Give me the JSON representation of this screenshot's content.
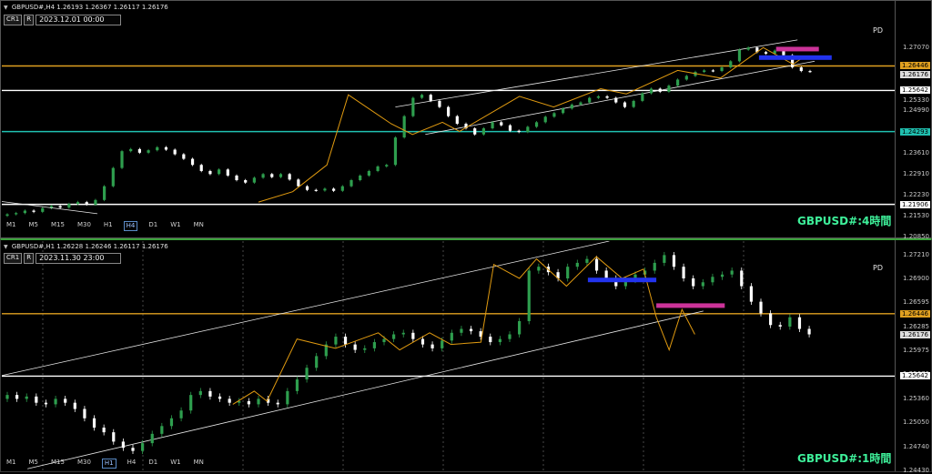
{
  "panels": [
    {
      "id": "h4",
      "symbol_info": "GBPUSD#,H4  1.26193 1.26367 1.26117 1.26176",
      "cr_label": "CR1",
      "r_label": "R",
      "datetime": "2023.12.01 00:00",
      "pd_label": "PD",
      "chart_label": "GBPUSD#:4時間",
      "timeframes": [
        "M1",
        "M5",
        "M15",
        "M30",
        "H1",
        "H4",
        "D1",
        "W1",
        "MN"
      ],
      "active_timeframe": "H4",
      "y_range": [
        1.2085,
        1.2855
      ],
      "ticks": [
        "1.27070",
        "1.25330",
        "1.24990",
        "1.23610",
        "1.22910",
        "1.22230",
        "1.21530",
        "1.20850"
      ],
      "ticks_vals": [
        1.2707,
        1.2533,
        1.2499,
        1.2361,
        1.2291,
        1.2223,
        1.2153,
        1.2085
      ],
      "price_tags": [
        {
          "text": "1.26446",
          "value": 1.26446,
          "bg": "#e0a020",
          "fg": "#000000"
        },
        {
          "text": "1.26176",
          "value": 1.26176,
          "bg": "#dddddd",
          "fg": "#000000"
        },
        {
          "text": "1.25642",
          "value": 1.25642,
          "bg": "#ffffff",
          "fg": "#000000"
        },
        {
          "text": "1.24293",
          "value": 1.24293,
          "bg": "#20c0b0",
          "fg": "#000000"
        },
        {
          "text": "1.21906",
          "value": 1.21906,
          "bg": "#ffffff",
          "fg": "#000000"
        }
      ],
      "hlines": [
        {
          "value": 1.26446,
          "color": "#e0a020"
        },
        {
          "value": 1.25642,
          "color": "#ffffff"
        },
        {
          "value": 1.24293,
          "color": "#20c0b0"
        },
        {
          "value": 1.21906,
          "color": "#ffffff"
        }
      ],
      "closes": [
        1.2158,
        1.2162,
        1.217,
        1.2166,
        1.2178,
        1.2185,
        1.218,
        1.2192,
        1.2198,
        1.219,
        1.2205,
        1.225,
        1.231,
        1.2365,
        1.2372,
        1.236,
        1.2368,
        1.2378,
        1.237,
        1.2355,
        1.234,
        1.232,
        1.23,
        1.229,
        1.2305,
        1.2285,
        1.227,
        1.2262,
        1.2278,
        1.229,
        1.228,
        1.229,
        1.2272,
        1.225,
        1.2238,
        1.2236,
        1.2242,
        1.2235,
        1.225,
        1.227,
        1.2285,
        1.23,
        1.2315,
        1.232,
        1.241,
        1.248,
        1.254,
        1.255,
        1.253,
        1.251,
        1.248,
        1.2455,
        1.244,
        1.242,
        1.244,
        1.246,
        1.245,
        1.2432,
        1.2428,
        1.2445,
        1.246,
        1.2478,
        1.249,
        1.2505,
        1.2518,
        1.2525,
        1.254,
        1.2545,
        1.254,
        1.2525,
        1.251,
        1.253,
        1.2555,
        1.257,
        1.256,
        1.258,
        1.26,
        1.2612,
        1.2625,
        1.263,
        1.2628,
        1.264,
        1.266,
        1.2698,
        1.2705,
        1.269,
        1.2685,
        1.2695,
        1.268,
        1.264,
        1.2628,
        1.2626
      ],
      "zigzag": [
        [
          0.3,
          1.2198
        ],
        [
          0.34,
          1.2232
        ],
        [
          0.38,
          1.232
        ],
        [
          0.405,
          1.255
        ],
        [
          0.455,
          1.2455
        ],
        [
          0.48,
          1.242
        ],
        [
          0.515,
          1.246
        ],
        [
          0.535,
          1.243
        ],
        [
          0.605,
          1.2545
        ],
        [
          0.645,
          1.251
        ],
        [
          0.7,
          1.257
        ],
        [
          0.73,
          1.2553
        ],
        [
          0.79,
          1.263
        ],
        [
          0.84,
          1.2605
        ],
        [
          0.89,
          1.2705
        ],
        [
          0.925,
          1.265
        ],
        [
          0.935,
          1.267
        ]
      ],
      "channel": [
        [
          [
            0.46,
            1.251
          ],
          [
            0.93,
            1.273
          ]
        ],
        [
          [
            0.495,
            1.242
          ],
          [
            0.95,
            1.266
          ]
        ]
      ],
      "blocks": [
        {
          "x0": 0.905,
          "x1": 0.955,
          "value": 1.27,
          "color": "#cc3399"
        },
        {
          "x0": 0.885,
          "x1": 0.97,
          "value": 1.2672,
          "color": "#2233ee"
        }
      ]
    },
    {
      "id": "h1",
      "symbol_info": "GBPUSD#,H1  1.26228 1.26246 1.26117 1.26176",
      "cr_label": "CR1",
      "r_label": "R",
      "datetime": "2023.11.30 23:00",
      "pd_label": "PD",
      "chart_label": "GBPUSD#:1時間",
      "timeframes": [
        "M1",
        "M5",
        "M15",
        "M30",
        "H1",
        "H4",
        "D1",
        "W1",
        "MN"
      ],
      "active_timeframe": "H1",
      "y_range": [
        1.2443,
        1.2738
      ],
      "ticks": [
        "1.27210",
        "1.26900",
        "1.26595",
        "1.26285",
        "1.25975",
        "1.25670",
        "1.25360",
        "1.25050",
        "1.24740",
        "1.24430"
      ],
      "ticks_vals": [
        1.2721,
        1.269,
        1.26595,
        1.26285,
        1.25975,
        1.2567,
        1.2536,
        1.2505,
        1.2474,
        1.2443
      ],
      "price_tags": [
        {
          "text": "1.26446",
          "value": 1.26446,
          "bg": "#e0a020",
          "fg": "#000000"
        },
        {
          "text": "1.26176",
          "value": 1.26176,
          "bg": "#dddddd",
          "fg": "#000000"
        },
        {
          "text": "1.25642",
          "value": 1.25642,
          "bg": "#ffffff",
          "fg": "#000000"
        }
      ],
      "hlines": [
        {
          "value": 1.26446,
          "color": "#e0a020"
        },
        {
          "value": 1.25642,
          "color": "#ffffff"
        }
      ],
      "closes": [
        1.254,
        1.2535,
        1.2538,
        1.253,
        1.2528,
        1.2535,
        1.253,
        1.2522,
        1.251,
        1.2498,
        1.2492,
        1.248,
        1.2472,
        1.2468,
        1.2478,
        1.249,
        1.25,
        1.251,
        1.252,
        1.254,
        1.2545,
        1.2538,
        1.2535,
        1.253,
        1.2532,
        1.2528,
        1.2535,
        1.253,
        1.2528,
        1.2545,
        1.256,
        1.2575,
        1.259,
        1.2605,
        1.2615,
        1.2605,
        1.2598,
        1.26,
        1.2608,
        1.2612,
        1.2618,
        1.262,
        1.2612,
        1.2605,
        1.26,
        1.261,
        1.262,
        1.2625,
        1.2622,
        1.2615,
        1.2608,
        1.2612,
        1.2618,
        1.2635,
        1.27,
        1.2705,
        1.2698,
        1.269,
        1.2705,
        1.271,
        1.2715,
        1.27,
        1.269,
        1.268,
        1.2688,
        1.2695,
        1.27,
        1.271,
        1.272,
        1.2705,
        1.269,
        1.268,
        1.2685,
        1.2692,
        1.2695,
        1.27,
        1.268,
        1.266,
        1.2645,
        1.263,
        1.2628,
        1.264,
        1.2625,
        1.2618
      ],
      "zigzag": [
        [
          0.27,
          1.2528
        ],
        [
          0.295,
          1.2545
        ],
        [
          0.31,
          1.2532
        ],
        [
          0.345,
          1.2612
        ],
        [
          0.39,
          1.26
        ],
        [
          0.44,
          1.262
        ],
        [
          0.465,
          1.2598
        ],
        [
          0.5,
          1.262
        ],
        [
          0.525,
          1.2605
        ],
        [
          0.56,
          1.2608
        ],
        [
          0.575,
          1.2708
        ],
        [
          0.605,
          1.269
        ],
        [
          0.625,
          1.2715
        ],
        [
          0.66,
          1.268
        ],
        [
          0.695,
          1.2718
        ],
        [
          0.725,
          1.269
        ],
        [
          0.75,
          1.2702
        ],
        [
          0.765,
          1.264
        ],
        [
          0.78,
          1.2598
        ],
        [
          0.795,
          1.265
        ],
        [
          0.81,
          1.2618
        ]
      ],
      "channel": [
        [
          [
            0.0,
            1.2565
          ],
          [
            0.71,
            1.2738
          ]
        ],
        [
          [
            0.03,
            1.2445
          ],
          [
            0.82,
            1.2648
          ]
        ]
      ],
      "blocks": [
        {
          "x0": 0.685,
          "x1": 0.765,
          "value": 1.2688,
          "color": "#2233ee"
        },
        {
          "x0": 0.765,
          "x1": 0.845,
          "value": 1.2655,
          "color": "#cc3399"
        }
      ]
    }
  ]
}
